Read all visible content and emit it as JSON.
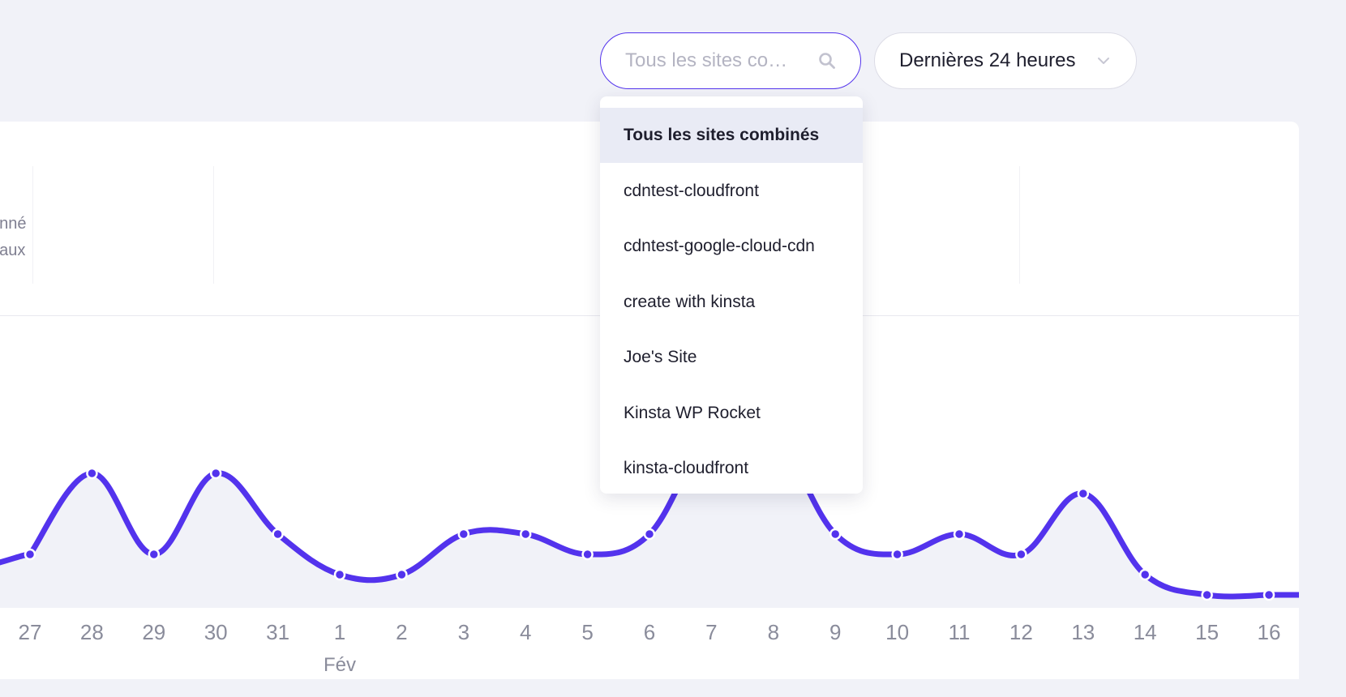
{
  "search": {
    "placeholder": "Tous les sites co…"
  },
  "range_select": {
    "label": "Dernières 24 heures"
  },
  "stats": {
    "label_line1": "onné",
    "label_line2": "naux"
  },
  "dropdown": {
    "items": [
      {
        "label": "Tous les sites combinés",
        "selected": true
      },
      {
        "label": "cdntest-cloudfront"
      },
      {
        "label": "cdntest-google-cloud-cdn"
      },
      {
        "label": "create with kinsta"
      },
      {
        "label": "Joe's Site"
      },
      {
        "label": "Kinsta WP Rocket"
      },
      {
        "label": "kinsta-cloudfront"
      }
    ]
  },
  "colors": {
    "accent": "#5333ed",
    "page_bg": "#f1f2f8",
    "plot_fill": "#f1f2f8"
  },
  "chart_data": {
    "type": "line",
    "x": [
      "27",
      "28",
      "29",
      "30",
      "31",
      "1",
      "2",
      "3",
      "4",
      "5",
      "6",
      "7",
      "8",
      "9",
      "10",
      "11",
      "12",
      "13",
      "14",
      "15",
      "16"
    ],
    "month_label": "Fév",
    "series": [
      {
        "values": [
          2,
          6,
          2,
          6,
          3,
          1,
          1,
          3,
          3,
          2,
          3,
          8,
          8,
          3,
          2,
          3,
          2,
          5,
          1,
          0,
          0
        ]
      }
    ],
    "ylim": [
      0,
      10
    ],
    "grid": false,
    "legend": "none"
  }
}
